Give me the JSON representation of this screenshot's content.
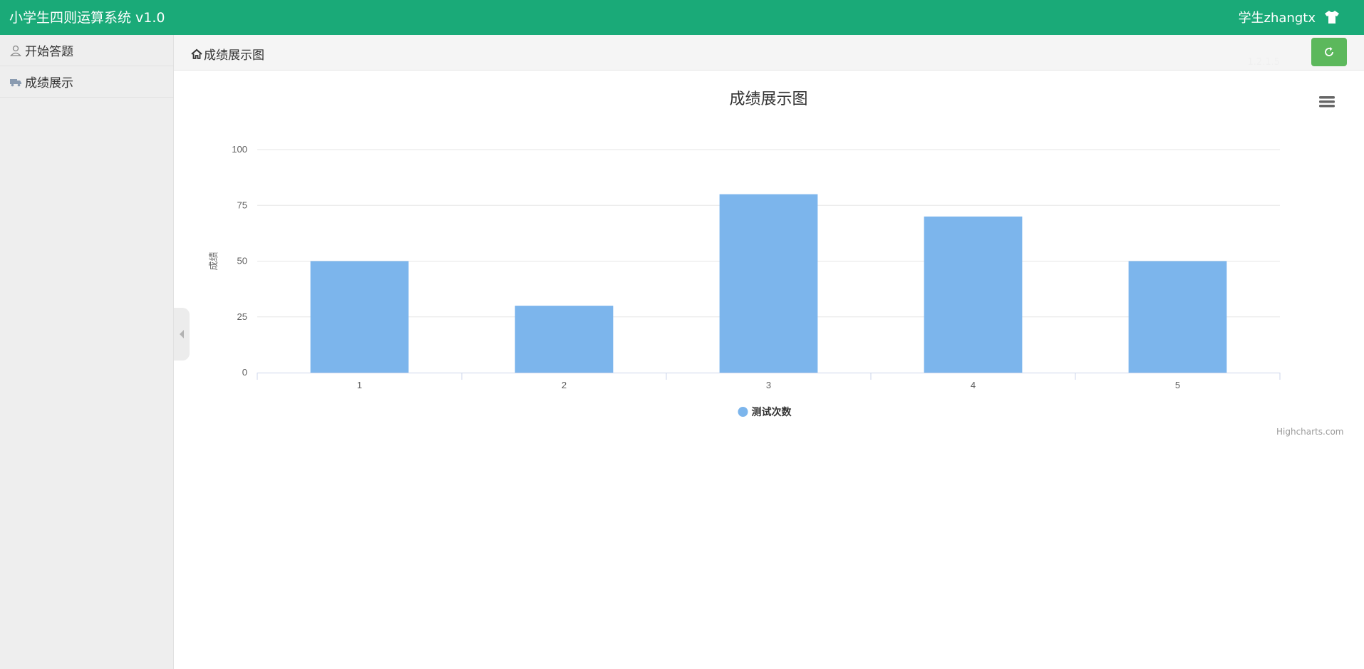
{
  "app": {
    "title": "小学生四则运算系统 v1.0"
  },
  "user": {
    "name": "学生zhangtx"
  },
  "sidebar": {
    "items": [
      {
        "label": "开始答题"
      },
      {
        "label": "成绩展示"
      }
    ]
  },
  "breadcrumb": {
    "label": "成绩展示图"
  },
  "header": {
    "faint_text": "1.2.1.5"
  },
  "colors": {
    "topbar": "#1aaa78",
    "bar": "#7cb5ec",
    "refresh": "#5cb85c"
  },
  "chart_data": {
    "type": "bar",
    "title": "成绩展示图",
    "xlabel": "",
    "ylabel": "成绩",
    "categories": [
      "1",
      "2",
      "3",
      "4",
      "5"
    ],
    "series": [
      {
        "name": "测试次数",
        "values": [
          50,
          30,
          80,
          70,
          50
        ]
      }
    ],
    "ylim": [
      0,
      100
    ],
    "yticks": [
      0,
      25,
      50,
      75,
      100
    ],
    "grid": true,
    "legend": "bottom-center",
    "credits": "Highcharts.com"
  }
}
